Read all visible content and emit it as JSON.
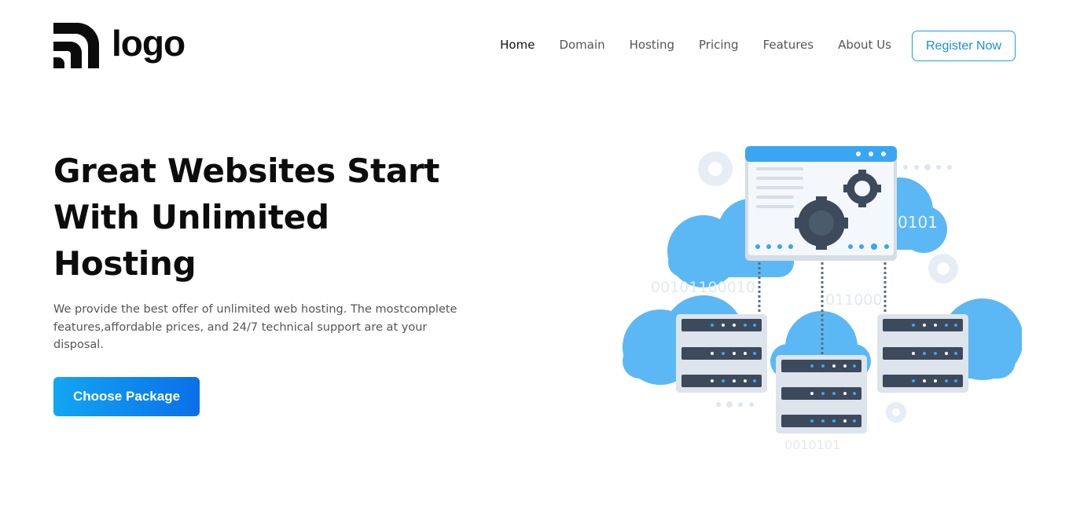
{
  "brand": {
    "logo_text": "logo"
  },
  "nav": {
    "items": [
      {
        "label": "Home",
        "active": true
      },
      {
        "label": "Domain"
      },
      {
        "label": "Hosting"
      },
      {
        "label": "Pricing"
      },
      {
        "label": "Features"
      },
      {
        "label": "About Us"
      }
    ],
    "register_label": "Register Now"
  },
  "hero": {
    "title_lines": [
      "Great Websites Start",
      "With Unlimited",
      "Hosting"
    ],
    "description": "We provide the best offer of unlimited web hosting. The mostcomplete features,affordable prices, and 24/7 technical support are at your disposal.",
    "cta_label": "Choose Package"
  },
  "illustration": {
    "binary_texts": [
      "0101",
      "00101100010",
      "011000",
      "0010101"
    ]
  },
  "colors": {
    "accent": "#1aa0e8",
    "cta_gradient_start": "#12a6f2",
    "cta_gradient_end": "#0a6fe9",
    "cloud": "#5bb8f5",
    "server_dark": "#3d4a5c"
  }
}
